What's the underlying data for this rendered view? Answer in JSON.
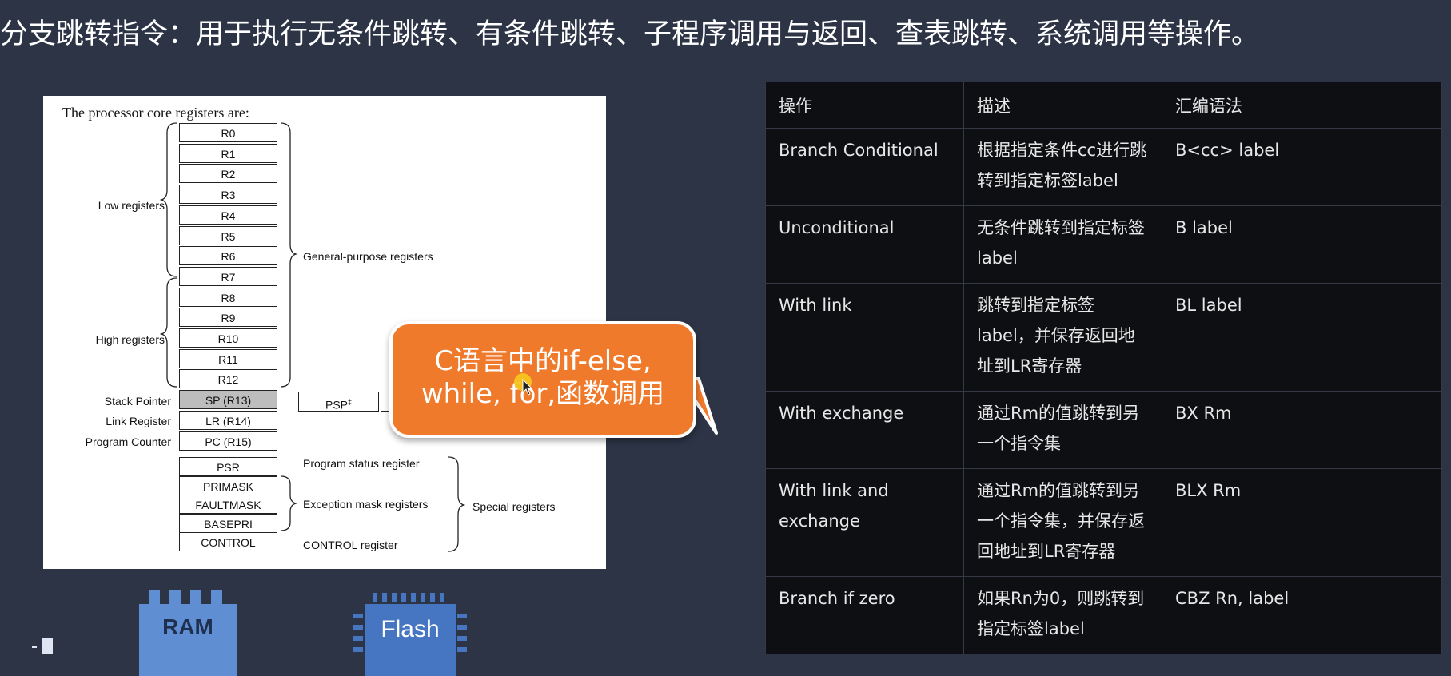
{
  "slide_title": "分支跳转指令：用于执行无条件跳转、有条件跳转、子程序调用与返回、查表跳转、系统调用等操作。",
  "diagram": {
    "intro": "The processor core registers are:",
    "registers": [
      "R0",
      "R1",
      "R2",
      "R3",
      "R4",
      "R5",
      "R6",
      "R7",
      "R8",
      "R9",
      "R10",
      "R11",
      "R12",
      "SP (R13)",
      "LR (R14)",
      "PC (R15)"
    ],
    "special_registers": [
      "PSR",
      "PRIMASK",
      "FAULTMASK",
      "BASEPRI",
      "CONTROL"
    ],
    "low_label": "Low registers",
    "high_label": "High registers",
    "general_label": "General-purpose registers",
    "sp_label": "Stack Pointer",
    "lr_label": "Link Register",
    "pc_label": "Program Counter",
    "psp_label": "PSP",
    "psp_mark": "‡",
    "psr_label": "Program status register",
    "exception_label": "Exception mask registers",
    "control_label": "CONTROL register",
    "special_label": "Special registers"
  },
  "chips": {
    "ram": "RAM",
    "flash": "Flash"
  },
  "callout": {
    "line1": "C语言中的if-else,",
    "line2": "while, for,函数调用"
  },
  "table": {
    "headers": [
      "操作",
      "描述",
      "汇编语法"
    ],
    "rows": [
      {
        "op": "Branch Conditional",
        "desc": "根据指定条件cc进行跳转到指定标签label",
        "syntax": "B<cc> label"
      },
      {
        "op": "Unconditional",
        "desc": "无条件跳转到指定标签label",
        "syntax": "B label"
      },
      {
        "op": "With link",
        "desc": "跳转到指定标签label，并保存返回地址到LR寄存器",
        "syntax": "BL label"
      },
      {
        "op": "With exchange",
        "desc": "通过Rm的值跳转到另一个指令集",
        "syntax": "BX Rm"
      },
      {
        "op": "With link and exchange",
        "desc": "通过Rm的值跳转到另一个指令集，并保存返回地址到LR寄存器",
        "syntax": "BLX Rm"
      },
      {
        "op": "Branch if zero",
        "desc": "如果Rn为0，则跳转到指定标签label",
        "syntax": "CBZ Rn, label"
      }
    ]
  },
  "colors": {
    "background": "#2c3446",
    "callout": "#ef7a2b",
    "table_bg": "#0e0f12",
    "ram_chip": "#5f8fd2",
    "flash_chip": "#4675c2"
  }
}
